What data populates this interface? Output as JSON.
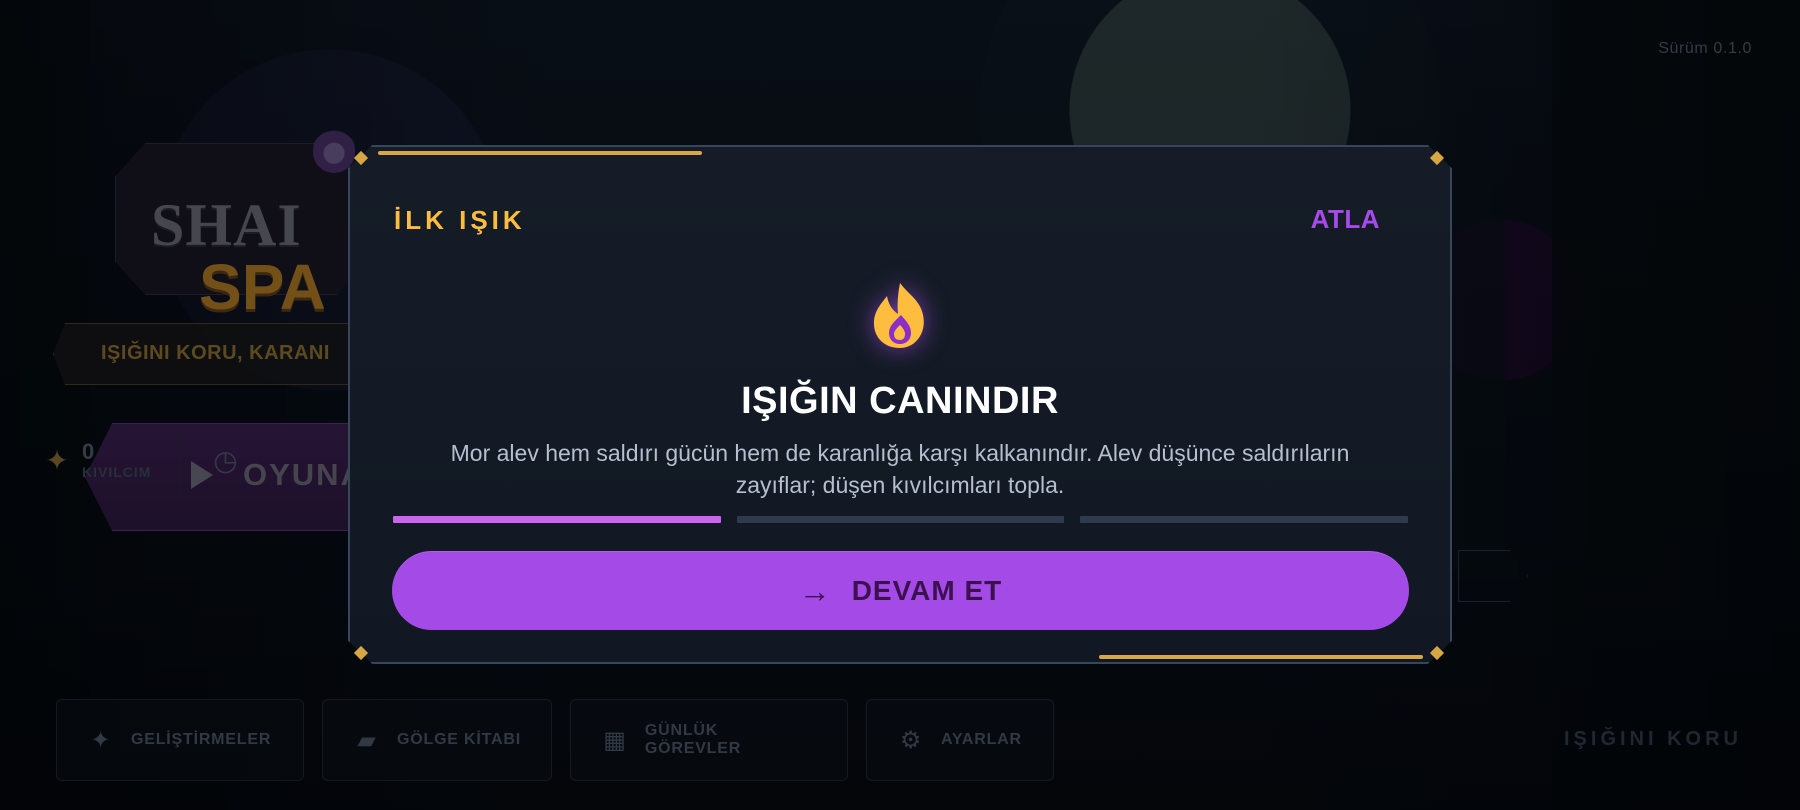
{
  "version_label": "Sürüm 0.1.0",
  "background_ui": {
    "logo_line1": "SHAI",
    "logo_line2": "SPA",
    "tagline": "IŞIĞINI KORU, KARANI",
    "play_button": "OYUNA",
    "stats": [
      {
        "icon": "sparkle-icon",
        "value": "0",
        "label": "KIVILCIM"
      },
      {
        "icon": "timer-icon",
        "value": "",
        "label": ""
      }
    ],
    "bottom_nav": [
      {
        "icon": "sparkle-icon",
        "label": "GELİŞTİRMELER"
      },
      {
        "icon": "book-icon",
        "label": "GÖLGE KİTABI"
      },
      {
        "icon": "calendar-icon",
        "label": "GÜNLÜK GÖREVLER"
      },
      {
        "icon": "gear-icon",
        "label": "AYARLAR"
      }
    ],
    "bottom_right_text": "IŞIĞINI KORU"
  },
  "dialog": {
    "title": "İLK IŞIK",
    "skip_label": "ATLA",
    "icon": "flame-icon",
    "headline": "IŞIĞIN CANINDIR",
    "description": "Mor alev hem saldırı gücün hem de karanlığa karşı kalkanındır. Alev düşünce saldırıların zayıflar; düşen kıvılcımları topla.",
    "progress": {
      "current_step": 1,
      "total_steps": 3
    },
    "continue_label": "DEVAM ET",
    "continue_icon": "arrow-right-icon"
  },
  "colors": {
    "accent_gold": "#ffbd3f",
    "accent_purple": "#a64bea",
    "button_purple": "#a44ae6",
    "progress_active": "#cd64ef"
  }
}
